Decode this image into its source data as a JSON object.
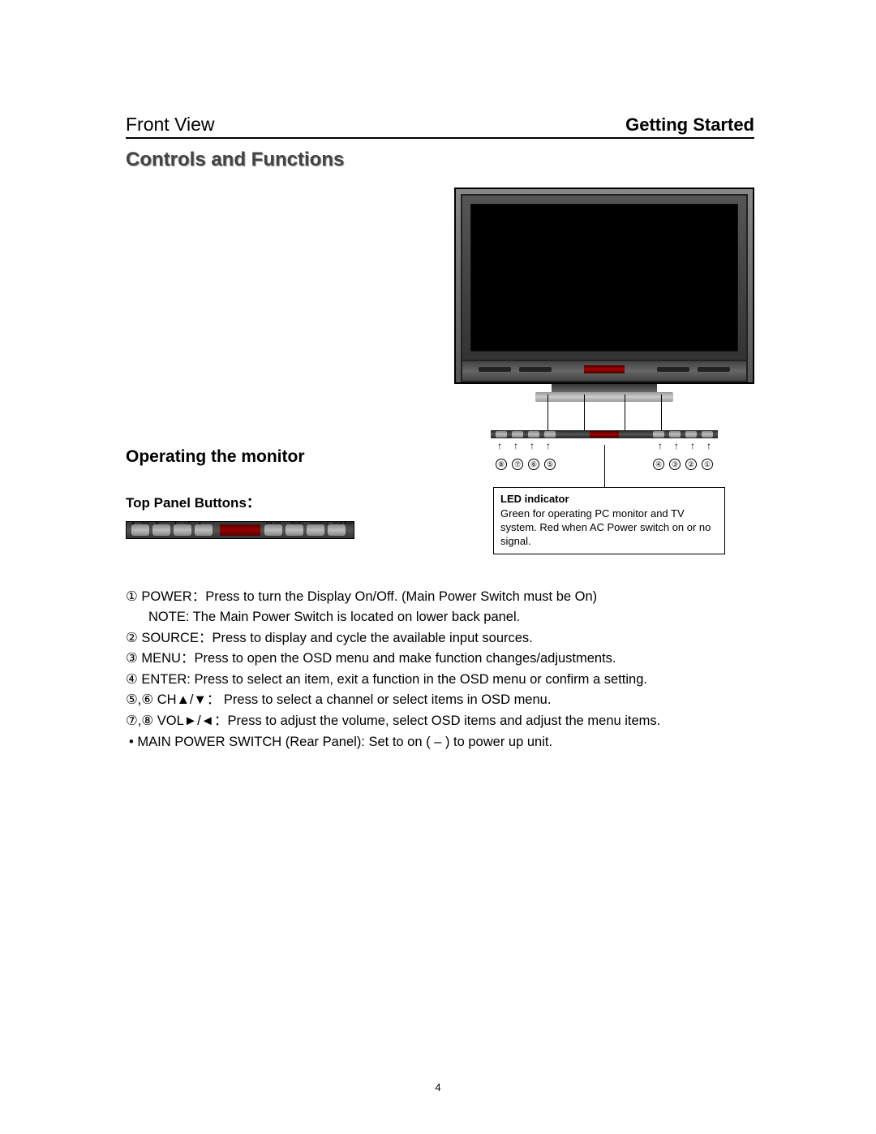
{
  "header": {
    "front_view": "Front View",
    "getting_started": "Getting Started"
  },
  "section_title": "Controls and Functions",
  "operating_heading": "Operating the monitor",
  "top_panel_label": "Top Panel Buttons：",
  "strip": {
    "vol_left_arrow": "◄",
    "vol_label": "VOL",
    "vol_right_arrow": "►",
    "ch_down_arrow": "▼",
    "ch_label": "CH",
    "ch_up_arrow": "▲",
    "enter": "ENTER",
    "menu": "MENU",
    "source": "SOURCE",
    "power": "POEWER"
  },
  "callout_numbers": [
    "⑧",
    "⑦",
    "⑥",
    "⑤",
    "④",
    "③",
    "②",
    "①"
  ],
  "led_box": {
    "title": "LED indicator",
    "body": "Green for operating PC monitor and TV system. Red when AC Power switch on or no signal."
  },
  "descriptions": [
    "① POWER：Press to turn the Display On/Off.  (Main Power Switch must be On)",
    "NOTE: The Main Power Switch is located on lower back panel.",
    "② SOURCE：Press to display and cycle the available input sources.",
    "③ MENU：Press to open the OSD menu and make function changes/adjustments.",
    "④ ENTER: Press to select an item, exit a function in the OSD menu or confirm a setting.",
    "⑤,⑥ CH▲/▼： Press to select a channel or select items in OSD menu.",
    "⑦,⑧ VOL►/◄：Press to adjust the volume, select OSD items and adjust the menu items.",
    "•  MAIN POWER  SWITCH (Rear Panel): Set to on ( – ) to power up unit."
  ],
  "page_number": "4"
}
